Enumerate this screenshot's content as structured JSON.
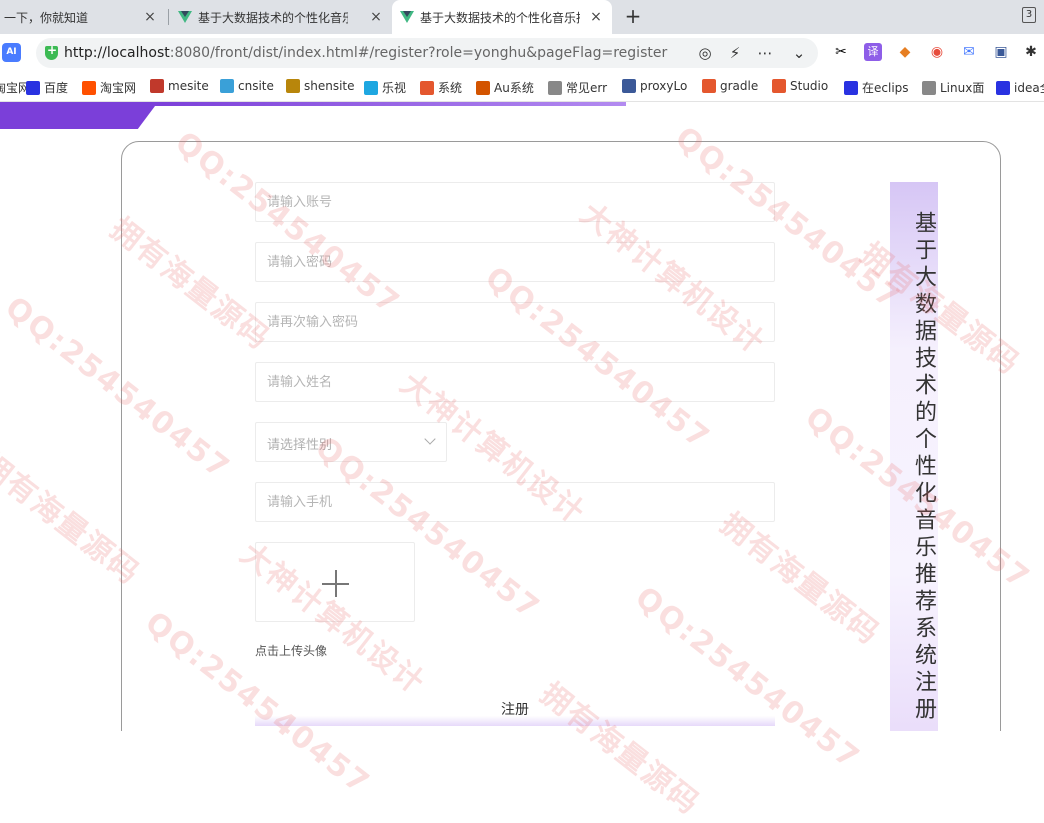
{
  "browser": {
    "tabs": [
      {
        "title": "一下，你就知道",
        "active": false
      },
      {
        "title": "基于大数据技术的个性化音乐推荐系统",
        "active": false
      },
      {
        "title": "基于大数据技术的个性化音乐推荐系统",
        "active": true
      }
    ],
    "new_tab_symbol": "+",
    "close_symbol": "×",
    "tab_count": "3",
    "ai_badge": "AI",
    "url_host": "http://localhost",
    "url_rest": ":8080/front/dist/index.html#/register?role=yonghu&pageFlag=register",
    "bookmarks": [
      {
        "label": "淘宝网",
        "color": "#ff5000"
      },
      {
        "label": "百度",
        "color": "#2932e1"
      },
      {
        "label": "淘宝网",
        "color": "#ff5000"
      },
      {
        "label": "mesite",
        "color": "#c0392b"
      },
      {
        "label": "cnsite",
        "color": "#3aa0d8"
      },
      {
        "label": "shensite",
        "color": "#b8860b"
      },
      {
        "label": "乐视",
        "color": "#1ea7e1"
      },
      {
        "label": "系统",
        "color": "#e4572e"
      },
      {
        "label": "Au系统",
        "color": "#d35400"
      },
      {
        "label": "常见err",
        "color": "#888888"
      },
      {
        "label": "proxyLo",
        "color": "#3b5998"
      },
      {
        "label": "gradle",
        "color": "#e4572e"
      },
      {
        "label": "Studio",
        "color": "#e4572e"
      },
      {
        "label": "在eclips",
        "color": "#2932e1"
      },
      {
        "label": "Linux面",
        "color": "#888888"
      },
      {
        "label": "idea全",
        "color": "#2932e1"
      }
    ]
  },
  "form": {
    "account_placeholder": "请输入账号",
    "password_placeholder": "请输入密码",
    "password_confirm_placeholder": "请再次输入密码",
    "name_placeholder": "请输入姓名",
    "gender_placeholder": "请选择性别",
    "phone_placeholder": "请输入手机",
    "upload_hint": "点击上传头像",
    "submit_label": "注册"
  },
  "side_title": "基于大数据技术的个性化音乐推荐系统注册",
  "watermark": [
    "QQ:254540457",
    "拥有海量源码",
    "大神计算机设计"
  ],
  "colors": {
    "accent": "#7b3fd9",
    "watermark": "#e66e6e"
  }
}
